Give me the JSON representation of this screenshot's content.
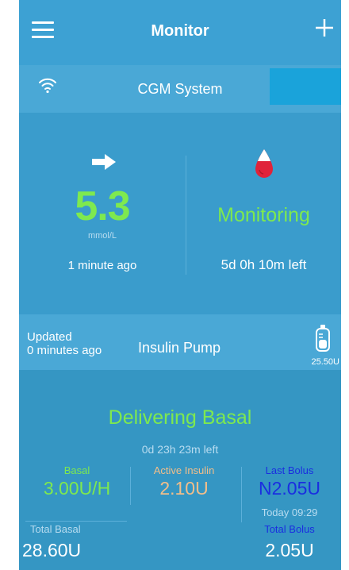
{
  "navbar": {
    "title": "Monitor",
    "menu_icon": "hamburger-menu-icon",
    "add_icon": "plus-icon"
  },
  "cgm": {
    "title": "CGM System",
    "signal_icon": "wifi-icon",
    "trend_icon": "arrow-right-icon",
    "glucose_value": "5.3",
    "glucose_unit": "mmol/L",
    "glucose_time": "1 minute ago",
    "status_icon": "blood-drop-icon",
    "status": "Monitoring",
    "sensor_left": "5d 0h 10m left"
  },
  "pump": {
    "updated_line1": "Updated",
    "updated_line2": "0 minutes ago",
    "title": "Insulin Pump",
    "reservoir_icon": "insulin-reservoir-icon",
    "reservoir_level": "25.50U",
    "status": "Delivering Basal",
    "basal_time_left": "0d 23h 23m left",
    "basal_label": "Basal",
    "basal_value": "3.00U/H",
    "active_insulin_label": "Active Insulin",
    "active_insulin_value": "2.10U",
    "last_bolus_label": "Last Bolus",
    "last_bolus_value": "N2.05U",
    "last_bolus_time": "Today 09:29",
    "total_basal_label": "Total Basal",
    "total_basal_value": "28.60U",
    "total_bolus_label": "Total Bolus",
    "total_bolus_value": "2.05U"
  },
  "colors": {
    "background": "#3596c3",
    "navbar": "#3da1d3",
    "section_header": "#4aa8d6",
    "accent_green": "#7ee94f",
    "active_insulin_orange": "#f2be8a",
    "bolus_blue": "#1a2ee0",
    "drop_red": "#e0233a"
  }
}
